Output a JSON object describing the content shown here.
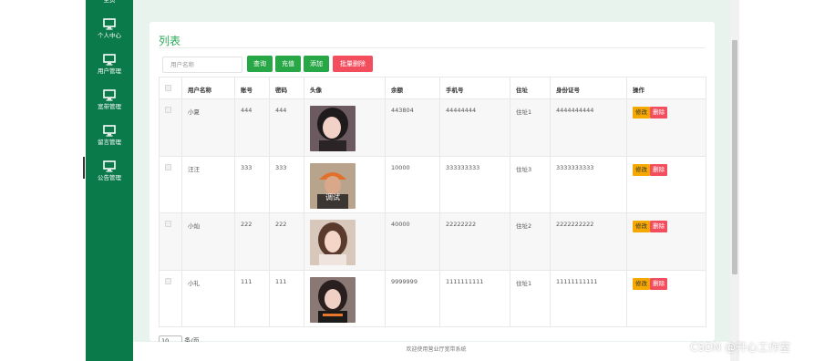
{
  "sidebar": {
    "items": [
      {
        "label": "主页",
        "icon": "home-icon"
      },
      {
        "label": "个人中心",
        "icon": "monitor-icon"
      },
      {
        "label": "用户管理",
        "icon": "monitor-icon"
      },
      {
        "label": "宽带管理",
        "icon": "monitor-icon"
      },
      {
        "label": "留言管理",
        "icon": "monitor-icon"
      },
      {
        "label": "公告管理",
        "icon": "monitor-icon"
      }
    ]
  },
  "card": {
    "title": "列表"
  },
  "toolbar": {
    "search_placeholder": "用户名称",
    "search_label": "查询",
    "recharge_label": "充值",
    "add_label": "添加",
    "batch_delete_label": "批量删除"
  },
  "table": {
    "headers": [
      "用户名称",
      "账号",
      "密码",
      "头像",
      "余额",
      "手机号",
      "住址",
      "身份证号",
      "操作"
    ],
    "rows": [
      {
        "name": "小夏",
        "account": "444",
        "password": "444",
        "balance": "443804",
        "phone": "44444444",
        "address": "住址1",
        "id_number": "4444444444"
      },
      {
        "name": "汪汪",
        "account": "333",
        "password": "333",
        "balance": "10000",
        "phone": "333333333",
        "address": "住址3",
        "id_number": "3333333333"
      },
      {
        "name": "小灿",
        "account": "222",
        "password": "222",
        "balance": "40000",
        "phone": "22222222",
        "address": "住址2",
        "id_number": "2222222222"
      },
      {
        "name": "小礼",
        "account": "111",
        "password": "111",
        "balance": "9999999",
        "phone": "1111111111",
        "address": "住址1",
        "id_number": "11111111111"
      }
    ],
    "edit_label": "修改",
    "delete_label": "删除",
    "avatar_caption_row2": "调试"
  },
  "pager": {
    "page_size": "10",
    "per_page_text": "条/页"
  },
  "footer": {
    "text": "欢迎使用营业厅宽带系统"
  },
  "watermark": {
    "text": "CSDN @开心工作室"
  },
  "colors": {
    "sidebar": "#0b7a4a",
    "accent_green": "#27a745",
    "danger": "#f24e5e",
    "warning": "#f5a800"
  }
}
